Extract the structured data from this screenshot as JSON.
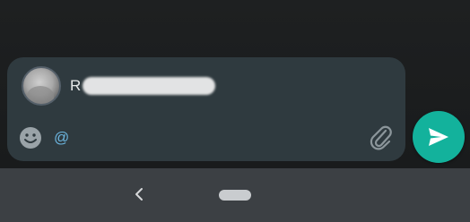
{
  "composer": {
    "mention": {
      "avatar_icon": "contact-avatar",
      "name_visible": "R"
    },
    "input": {
      "value": "@",
      "placeholder": ""
    },
    "emoji_icon": "emoji-face-icon",
    "attach_icon": "paperclip-icon"
  },
  "send_button": {
    "icon": "send-arrow-icon",
    "color": "#13b29c"
  },
  "nav_bar": {
    "back_icon": "chevron-left-icon",
    "home_icon": "home-pill-icon"
  }
}
